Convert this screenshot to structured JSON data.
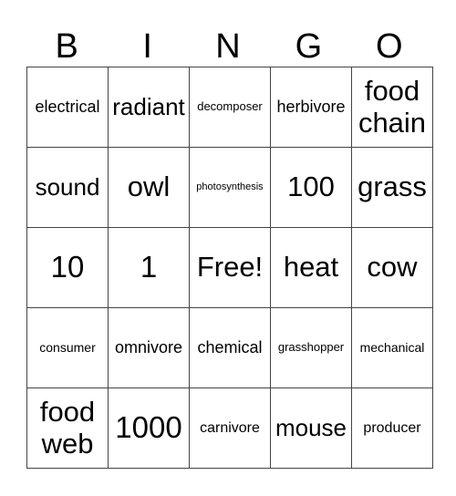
{
  "header": [
    "B",
    "I",
    "N",
    "G",
    "O"
  ],
  "rows": [
    [
      "electrical",
      "radiant",
      "decomposer",
      "herbivore",
      "food chain"
    ],
    [
      "sound",
      "owl",
      "photosynthesis",
      "100",
      "grass"
    ],
    [
      "10",
      "1",
      "Free!",
      "heat",
      "cow"
    ],
    [
      "consumer",
      "omnivore",
      "chemical",
      "grasshopper",
      "mechanical"
    ],
    [
      "food web",
      "1000",
      "carnivore",
      "mouse",
      "producer"
    ]
  ]
}
